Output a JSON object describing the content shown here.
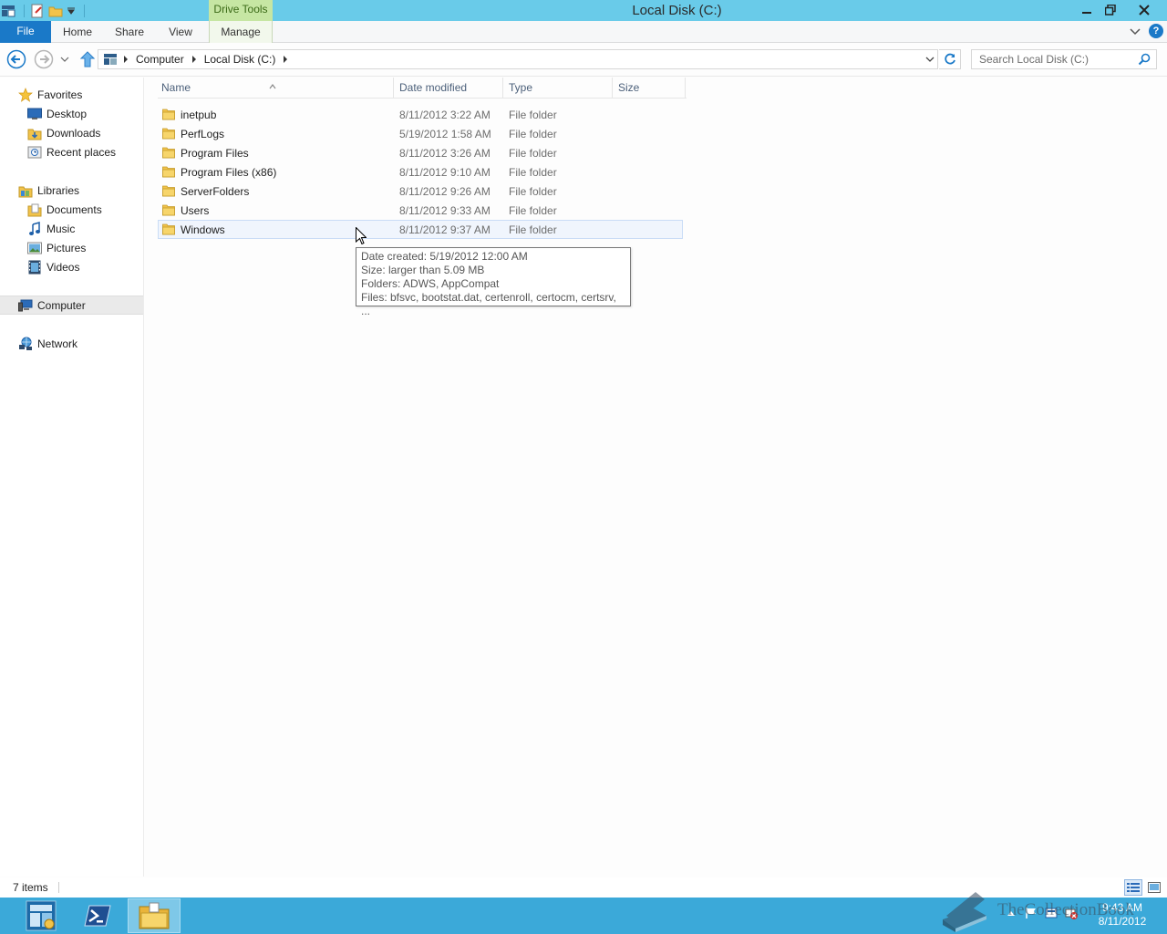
{
  "window": {
    "title": "Local Disk (C:)",
    "context_tab": "Drive Tools"
  },
  "ribbon": {
    "tabs": {
      "file": "File",
      "home": "Home",
      "share": "Share",
      "view": "View",
      "manage": "Manage"
    },
    "help": "?"
  },
  "address": {
    "crumbs": [
      "Computer",
      "Local Disk (C:)"
    ]
  },
  "search": {
    "placeholder": "Search Local Disk (C:)"
  },
  "sidebar": {
    "favorites": "Favorites",
    "favorites_items": [
      "Desktop",
      "Downloads",
      "Recent places"
    ],
    "libraries": "Libraries",
    "libraries_items": [
      "Documents",
      "Music",
      "Pictures",
      "Videos"
    ],
    "computer": "Computer",
    "network": "Network"
  },
  "columns": {
    "name": "Name",
    "date": "Date modified",
    "type": "Type",
    "size": "Size"
  },
  "files": [
    {
      "name": "inetpub",
      "date": "8/11/2012 3:22 AM",
      "type": "File folder"
    },
    {
      "name": "PerfLogs",
      "date": "5/19/2012 1:58 AM",
      "type": "File folder"
    },
    {
      "name": "Program Files",
      "date": "8/11/2012 3:26 AM",
      "type": "File folder"
    },
    {
      "name": "Program Files (x86)",
      "date": "8/11/2012 9:10 AM",
      "type": "File folder"
    },
    {
      "name": "ServerFolders",
      "date": "8/11/2012 9:26 AM",
      "type": "File folder"
    },
    {
      "name": "Users",
      "date": "8/11/2012 9:33 AM",
      "type": "File folder"
    },
    {
      "name": "Windows",
      "date": "8/11/2012 9:37 AM",
      "type": "File folder"
    }
  ],
  "tooltip": {
    "lines": [
      "Date created: 5/19/2012 12:00 AM",
      "Size: larger than 5.09 MB",
      "Folders: ADWS, AppCompat",
      "Files: bfsvc, bootstat.dat, certenroll, certocm, certsrv, ..."
    ]
  },
  "status": {
    "count": "7 items"
  },
  "taskbar": {
    "time": "9:43 AM",
    "date": "8/11/2012"
  },
  "watermark": {
    "text": "TheCollectionBook"
  },
  "colors": {
    "titlebar": "#69cbe9",
    "accent": "#1a79c8",
    "taskbar": "#3ba9d9",
    "context_tab": "#c6e6a3"
  },
  "icons": {
    "back": "back-arrow-icon",
    "forward": "forward-arrow-icon",
    "up": "up-arrow-icon",
    "refresh": "refresh-icon",
    "search": "search-icon",
    "folder": "folder-icon"
  }
}
